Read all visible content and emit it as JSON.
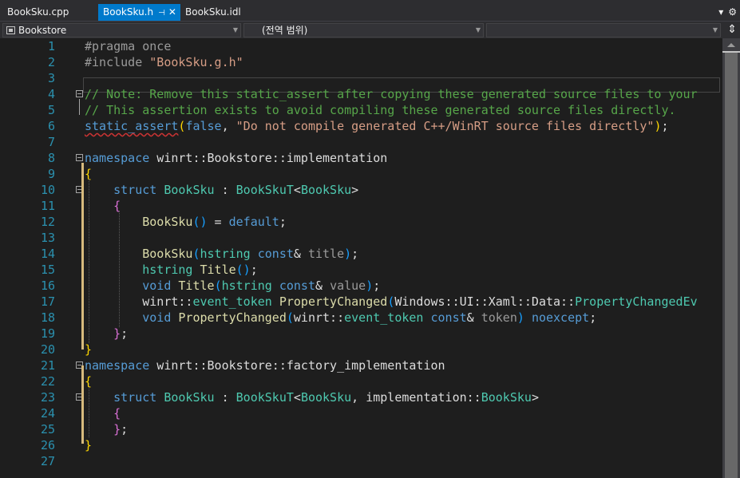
{
  "tabs": [
    {
      "label": "BookSku.cpp",
      "active": false
    },
    {
      "label": "BookSku.h",
      "active": true,
      "pin_icon": "pin-icon",
      "close_icon": "close-icon"
    },
    {
      "label": "BookSku.idl",
      "active": false
    }
  ],
  "tabbar_right": {
    "dropdown_icon": "chevron-down-icon",
    "settings_icon": "gear-icon"
  },
  "navbar": {
    "project": "Bookstore",
    "scope": "(전역 범위)",
    "member": ""
  },
  "colors": {
    "keyword": "#569cd6",
    "type": "#4ec9b0",
    "string": "#d69d85",
    "comment": "#57a64a",
    "function": "#dcdcaa",
    "line_number": "#2b91af",
    "active_tab": "#007acc"
  },
  "editor": {
    "line_numbers": [
      "1",
      "2",
      "3",
      "4",
      "5",
      "6",
      "7",
      "8",
      "9",
      "10",
      "11",
      "12",
      "13",
      "14",
      "15",
      "16",
      "17",
      "18",
      "19",
      "20",
      "21",
      "22",
      "23",
      "24",
      "25",
      "26",
      "27"
    ],
    "lines": [
      [
        {
          "t": "#pragma once",
          "c": "pp"
        }
      ],
      [
        {
          "t": "#include ",
          "c": "pp"
        },
        {
          "t": "\"BookSku.g.h\"",
          "c": "s"
        }
      ],
      [],
      [
        {
          "t": "// Note: Remove this static_assert after copying these generated source files to your",
          "c": "c"
        }
      ],
      [
        {
          "t": "// This assertion exists to avoid compiling these generated source files directly.",
          "c": "c"
        }
      ],
      [
        {
          "t": "static_assert",
          "c": "sa"
        },
        {
          "t": "(",
          "c": "b1"
        },
        {
          "t": "false",
          "c": "k"
        },
        {
          "t": ", ",
          "c": ""
        },
        {
          "t": "\"Do not compile generated C++/WinRT source files directly\"",
          "c": "s"
        },
        {
          "t": ")",
          "c": "b1"
        },
        {
          "t": ";",
          "c": ""
        }
      ],
      [],
      [
        {
          "t": "namespace",
          "c": "k"
        },
        {
          "t": " winrt::Bookstore::implementation",
          "c": ""
        }
      ],
      [
        {
          "t": "{",
          "c": "b1"
        }
      ],
      [
        {
          "t": "    ",
          "c": ""
        },
        {
          "t": "struct",
          "c": "k"
        },
        {
          "t": " ",
          "c": ""
        },
        {
          "t": "BookSku",
          "c": "t"
        },
        {
          "t": " : ",
          "c": ""
        },
        {
          "t": "BookSkuT",
          "c": "t"
        },
        {
          "t": "<",
          "c": ""
        },
        {
          "t": "BookSku",
          "c": "t"
        },
        {
          "t": ">",
          "c": ""
        }
      ],
      [
        {
          "t": "    ",
          "c": ""
        },
        {
          "t": "{",
          "c": "b2"
        }
      ],
      [
        {
          "t": "        ",
          "c": ""
        },
        {
          "t": "BookSku",
          "c": "f"
        },
        {
          "t": "()",
          "c": "b3"
        },
        {
          "t": " = ",
          "c": ""
        },
        {
          "t": "default",
          "c": "k"
        },
        {
          "t": ";",
          "c": ""
        }
      ],
      [],
      [
        {
          "t": "        ",
          "c": ""
        },
        {
          "t": "BookSku",
          "c": "f"
        },
        {
          "t": "(",
          "c": "b3"
        },
        {
          "t": "hstring",
          "c": "t"
        },
        {
          "t": " ",
          "c": ""
        },
        {
          "t": "const",
          "c": "k"
        },
        {
          "t": "& ",
          "c": ""
        },
        {
          "t": "title",
          "c": "p"
        },
        {
          "t": ")",
          "c": "b3"
        },
        {
          "t": ";",
          "c": ""
        }
      ],
      [
        {
          "t": "        ",
          "c": ""
        },
        {
          "t": "hstring",
          "c": "t"
        },
        {
          "t": " ",
          "c": ""
        },
        {
          "t": "Title",
          "c": "f"
        },
        {
          "t": "()",
          "c": "b3"
        },
        {
          "t": ";",
          "c": ""
        }
      ],
      [
        {
          "t": "        ",
          "c": ""
        },
        {
          "t": "void",
          "c": "k"
        },
        {
          "t": " ",
          "c": ""
        },
        {
          "t": "Title",
          "c": "f"
        },
        {
          "t": "(",
          "c": "b3"
        },
        {
          "t": "hstring",
          "c": "t"
        },
        {
          "t": " ",
          "c": ""
        },
        {
          "t": "const",
          "c": "k"
        },
        {
          "t": "& ",
          "c": ""
        },
        {
          "t": "value",
          "c": "p"
        },
        {
          "t": ")",
          "c": "b3"
        },
        {
          "t": ";",
          "c": ""
        }
      ],
      [
        {
          "t": "        ",
          "c": ""
        },
        {
          "t": "winrt",
          "c": ""
        },
        {
          "t": "::",
          "c": ""
        },
        {
          "t": "event_token",
          "c": "t"
        },
        {
          "t": " ",
          "c": ""
        },
        {
          "t": "PropertyChanged",
          "c": "f"
        },
        {
          "t": "(",
          "c": "b3"
        },
        {
          "t": "Windows::UI::Xaml::Data::",
          "c": ""
        },
        {
          "t": "PropertyChangedEv",
          "c": "t"
        }
      ],
      [
        {
          "t": "        ",
          "c": ""
        },
        {
          "t": "void",
          "c": "k"
        },
        {
          "t": " ",
          "c": ""
        },
        {
          "t": "PropertyChanged",
          "c": "f"
        },
        {
          "t": "(",
          "c": "b3"
        },
        {
          "t": "winrt::",
          "c": ""
        },
        {
          "t": "event_token",
          "c": "t"
        },
        {
          "t": " ",
          "c": ""
        },
        {
          "t": "const",
          "c": "k"
        },
        {
          "t": "& ",
          "c": ""
        },
        {
          "t": "token",
          "c": "p"
        },
        {
          "t": ")",
          "c": "b3"
        },
        {
          "t": " ",
          "c": ""
        },
        {
          "t": "noexcept",
          "c": "k"
        },
        {
          "t": ";",
          "c": ""
        }
      ],
      [
        {
          "t": "    ",
          "c": ""
        },
        {
          "t": "}",
          "c": "b2"
        },
        {
          "t": ";",
          "c": ""
        }
      ],
      [
        {
          "t": "}",
          "c": "b1"
        }
      ],
      [
        {
          "t": "namespace",
          "c": "k"
        },
        {
          "t": " winrt::Bookstore::factory_implementation",
          "c": ""
        }
      ],
      [
        {
          "t": "{",
          "c": "b1"
        }
      ],
      [
        {
          "t": "    ",
          "c": ""
        },
        {
          "t": "struct",
          "c": "k"
        },
        {
          "t": " ",
          "c": ""
        },
        {
          "t": "BookSku",
          "c": "t"
        },
        {
          "t": " : ",
          "c": ""
        },
        {
          "t": "BookSkuT",
          "c": "t"
        },
        {
          "t": "<",
          "c": ""
        },
        {
          "t": "BookSku",
          "c": "t"
        },
        {
          "t": ", implementation::",
          "c": ""
        },
        {
          "t": "BookSku",
          "c": "t"
        },
        {
          "t": ">",
          "c": ""
        }
      ],
      [
        {
          "t": "    ",
          "c": ""
        },
        {
          "t": "{",
          "c": "b2"
        }
      ],
      [
        {
          "t": "    ",
          "c": ""
        },
        {
          "t": "}",
          "c": "b2"
        },
        {
          "t": ";",
          "c": ""
        }
      ],
      [
        {
          "t": "}",
          "c": "b1"
        }
      ],
      []
    ],
    "fold_lines": [
      4,
      8,
      10,
      21,
      23
    ]
  }
}
